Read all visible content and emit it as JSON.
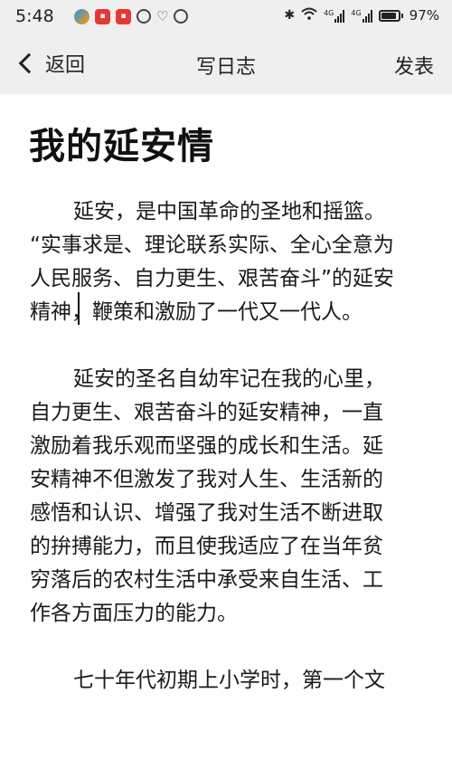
{
  "status_bar": {
    "time": "5:48",
    "battery": "97%",
    "network_labels": [
      "4G",
      "4G"
    ]
  },
  "nav": {
    "back_label": "返回",
    "title": "写日志",
    "publish_label": "发表"
  },
  "article": {
    "title": "我的延安情",
    "paragraphs": [
      {
        "lines": [
          "延安，是中国革命的圣地和摇篮。",
          "“实事求是、理论联系实际、全心全意为",
          "人民服务、自力更生、艰苦奋斗”的延安",
          "精神，鞭策和激励了一代又一代人。"
        ]
      },
      {
        "lines": [
          "延安的圣名自幼牢记在我的心里，",
          "自力更生、艰苦奋斗的延安精神，一直",
          "激励着我乐观而坚强的成长和生活。延",
          "安精神不但激发了我对人生、生活新的",
          "感悟和认识、增强了我对生活不断进取",
          "的拚搏能力，而且使我适应了在当年贫",
          "穷落后的农村生活中承受来自生活、工",
          "作各方面压力的能力。"
        ]
      },
      {
        "lines": [
          "七十年代初期上小学时，第一个文"
        ]
      }
    ]
  }
}
